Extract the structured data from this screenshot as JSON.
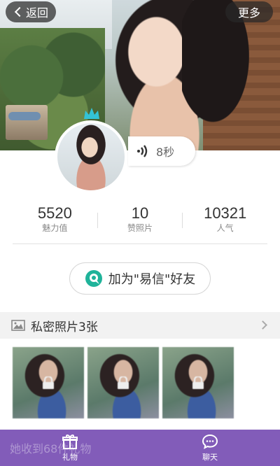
{
  "header": {
    "back_label": "返回",
    "more_label": "更多"
  },
  "voice": {
    "duration": "8秒"
  },
  "stats": [
    {
      "value": "5520",
      "label": "魅力值"
    },
    {
      "value": "10",
      "label": "赞照片"
    },
    {
      "value": "10321",
      "label": "人气"
    }
  ],
  "add_friend": {
    "label": "加为\"易信\"好友"
  },
  "private_photos": {
    "title": "私密照片3张",
    "count": 3
  },
  "gifts": {
    "text": "她收到68件礼物"
  },
  "tabbar": {
    "items": [
      {
        "label": "礼物",
        "icon": "gift-icon"
      },
      {
        "label": "聊天",
        "icon": "chat-icon"
      }
    ]
  },
  "colors": {
    "tabbar": "#7850b4",
    "yixin_green": "#1fb39a"
  }
}
